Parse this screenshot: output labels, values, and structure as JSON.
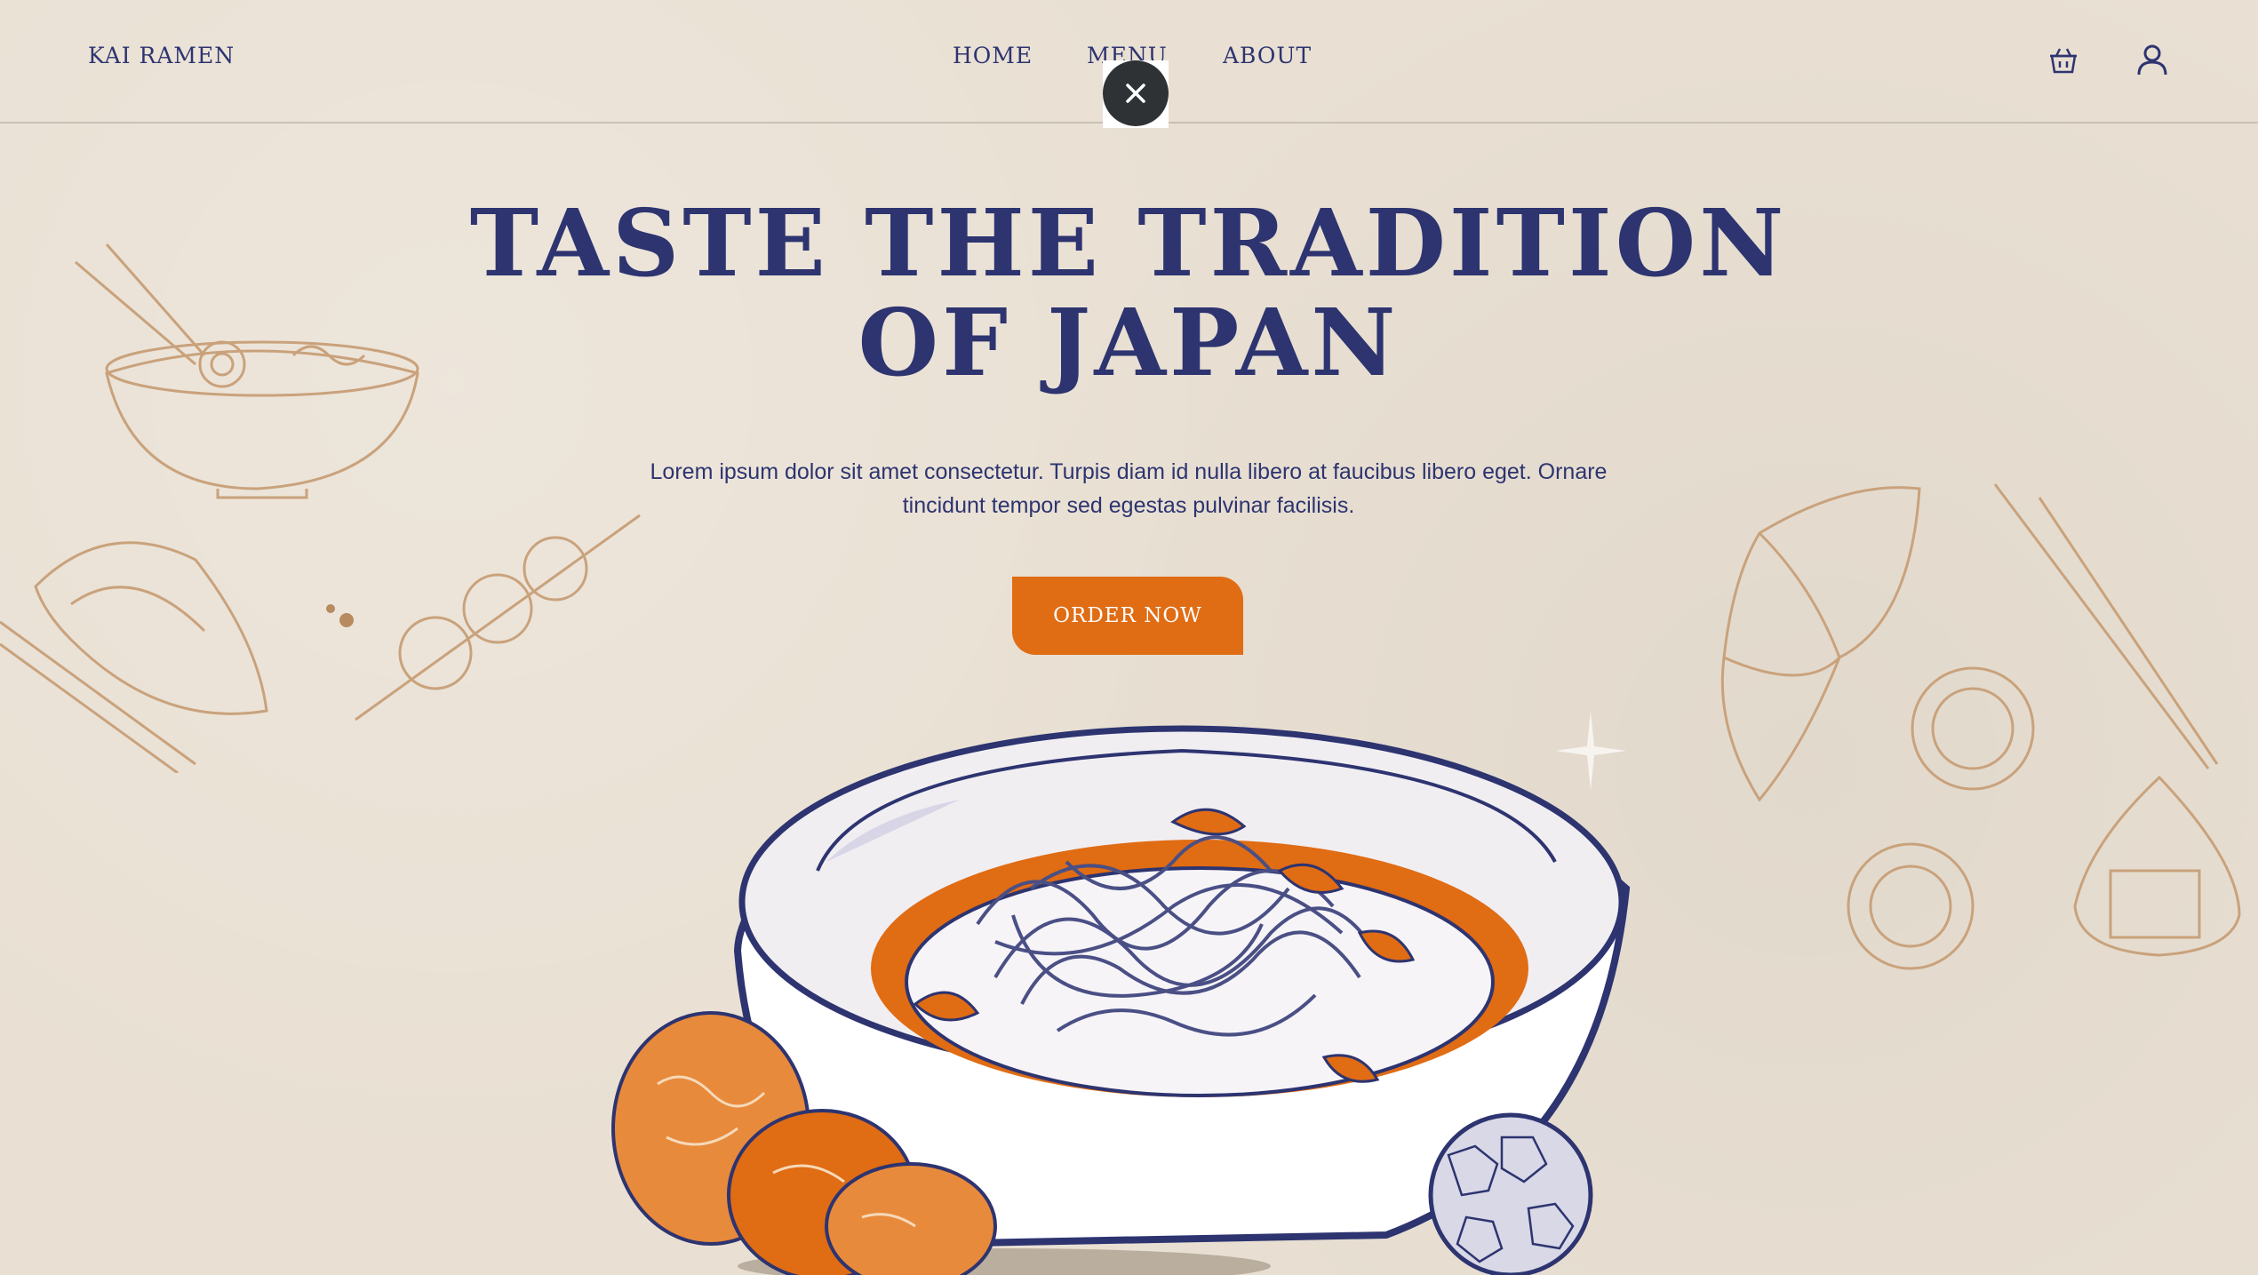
{
  "brand": {
    "logo": "KAI RAMEN"
  },
  "nav": {
    "home": "HOME",
    "menu": "MENU",
    "about": "ABOUT"
  },
  "overlay": {
    "close_icon": "close-icon"
  },
  "header_icons": [
    "basket-icon",
    "user-icon"
  ],
  "hero": {
    "title": "TASTE THE TRADITION OF JAPAN",
    "description": "Lorem ipsum dolor sit amet consectetur. Turpis diam id nulla libero at faucibus libero eget. Ornare tincidunt tempor sed egestas pulvinar facilisis.",
    "cta": "ORDER NOW"
  },
  "colors": {
    "background": "#e9e0d3",
    "primary_text": "#2d3470",
    "accent": "#e06c14",
    "sketch": "#c9a27c"
  }
}
